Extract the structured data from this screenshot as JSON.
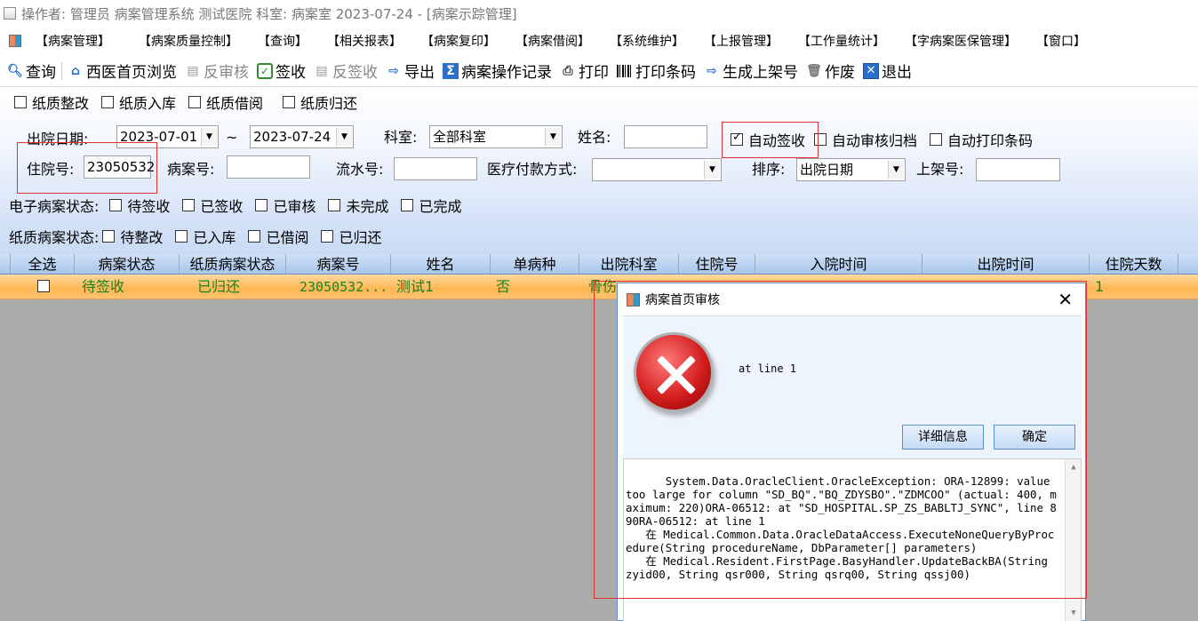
{
  "window": {
    "title": "操作者: 管理员  病案管理系统  测试医院  科室: 病案室  2023-07-24 - [病案示踪管理]"
  },
  "menu": [
    "【病案管理】",
    "【病案质量控制】",
    "【查询】",
    "【相关报表】",
    "【病案复印】",
    "【病案借阅】",
    "【系统维护】",
    "【上报管理】",
    "【工作量统计】",
    "【字病案医保管理】",
    "【窗口】"
  ],
  "toolbar": {
    "query": "查询",
    "western_browse": "西医首页浏览",
    "reverse_audit": "反审核",
    "sign_in": "签收",
    "reverse_sign": "反签收",
    "export": "导出",
    "op_log": "病案操作记录",
    "print": "打印",
    "print_barcode": "打印条码",
    "gen_shelf_no": "生成上架号",
    "void": "作废",
    "exit": "退出"
  },
  "paper_checks": [
    "纸质整改",
    "纸质入库",
    "纸质借阅",
    "纸质归还"
  ],
  "filters": {
    "discharge_date_label": "出院日期:",
    "date_from": "2023-07-01",
    "tilde": "~",
    "date_to": "2023-07-24",
    "dept_label": "科室:",
    "dept_value": "全部科室",
    "name_label": "姓名:",
    "auto_sign": "自动签收",
    "auto_audit": "自动审核归档",
    "auto_print": "自动打印条码",
    "inpatient_no_label": "住院号:",
    "inpatient_no_value": "23050532",
    "case_no_label": "病案号:",
    "serial_no_label": "流水号:",
    "payment_label": "医疗付款方式:",
    "sort_label": "排序:",
    "sort_value": "出院日期",
    "shelf_no_label": "上架号:",
    "e_status_label": "电子病案状态:",
    "e_status": [
      "待签收",
      "已签收",
      "已审核",
      "未完成",
      "已完成"
    ],
    "p_status_label": "纸质病案状态:",
    "p_status": [
      "待整改",
      "已入库",
      "已借阅",
      "已归还"
    ]
  },
  "grid": {
    "columns": [
      "全选",
      "病案状态",
      "纸质病案状态",
      "病案号",
      "姓名",
      "单病种",
      "出院科室",
      "住院号",
      "入院时间",
      "出院时间",
      "住院天数"
    ],
    "row": {
      "status": "待签收",
      "paper_status": "已归还",
      "case_no": "23050532...",
      "name": "测试1",
      "single_disease": "否",
      "dept": "骨伤",
      "days": "1"
    }
  },
  "dialog": {
    "title": "病案首页审核",
    "message": "at line 1",
    "details_button": "详细信息",
    "ok_button": "确定",
    "detail_text": "System.Data.OracleClient.OracleException: ORA-12899: value too large for column \"SD_BQ\".\"BQ_ZDYSBO\".\"ZDMCOO\" (actual: 400, maximum: 220)ORA-06512: at \"SD_HOSPITAL.SP_ZS_BABLTJ_SYNC\", line 890RA-06512: at line 1\n   在 Medical.Common.Data.OracleDataAccess.ExecuteNoneQueryByProcedure(String procedureName, DbParameter[] parameters)\n   在 Medical.Resident.FirstPage.BasyHandler.UpdateBackBA(String zyid00, String qsr000, String qsrq00, String qssj00)"
  },
  "colors": {
    "panel_gradient_bottom": "#c8daf4",
    "row_highlight": "#ffb652",
    "row_text": "#208020",
    "highlight_border": "#e03030"
  }
}
